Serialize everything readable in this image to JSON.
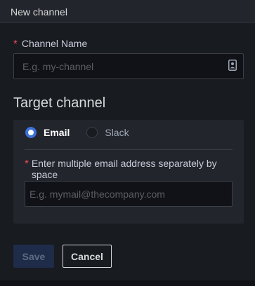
{
  "header": {
    "title": "New channel"
  },
  "channel_name": {
    "label": "Channel Name",
    "required_mark": "*",
    "placeholder": "E.g. my-channel",
    "value": ""
  },
  "target": {
    "title": "Target channel",
    "options": [
      {
        "label": "Email",
        "selected": true
      },
      {
        "label": "Slack",
        "selected": false
      }
    ],
    "email_field": {
      "required_mark": "*",
      "label": "Enter multiple email address separately by space",
      "placeholder": "E.g. mymail@thecompany.com",
      "value": ""
    }
  },
  "footer": {
    "save_label": "Save",
    "cancel_label": "Cancel"
  },
  "colors": {
    "accent": "#3d71d9",
    "required": "#f2495c",
    "save_disabled_bg": "#1f2c49"
  },
  "icons": {
    "channel_name_suffix": "id-card-icon"
  }
}
